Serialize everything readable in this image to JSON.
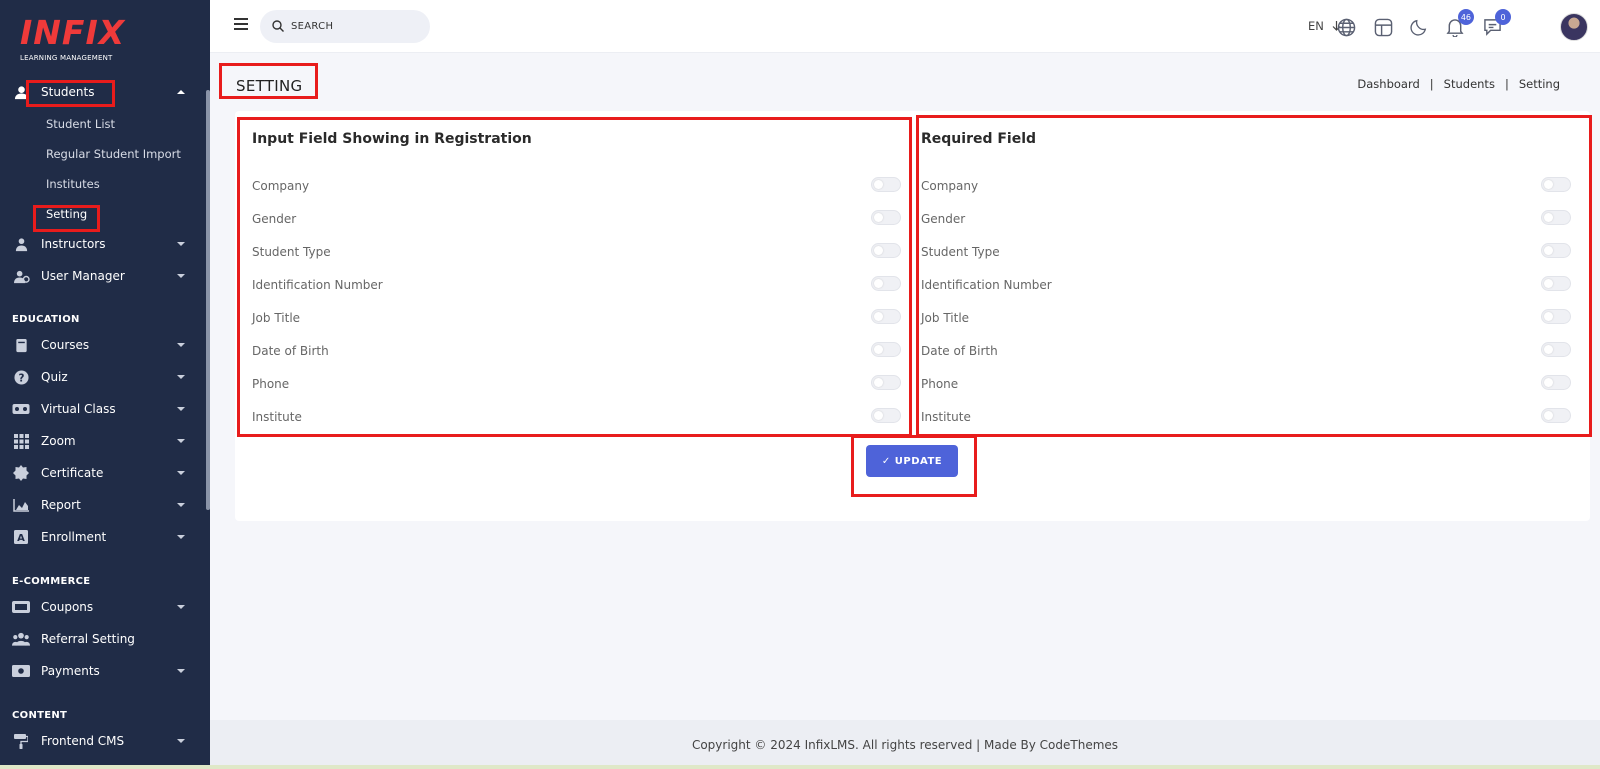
{
  "logo": {
    "main": "INFIX",
    "sub": "LEARNING MANAGEMENT"
  },
  "sidebar": {
    "students": {
      "label": "Students",
      "items": [
        "Student List",
        "Regular Student Import",
        "Institutes",
        "Setting"
      ]
    },
    "items_top": [
      {
        "label": "Instructors",
        "icon": "instructor-icon"
      },
      {
        "label": "User Manager",
        "icon": "user-manager-icon"
      }
    ],
    "sections": {
      "education": "EDUCATION",
      "ecommerce": "E-COMMERCE",
      "content": "CONTENT"
    },
    "education_items": [
      {
        "label": "Courses",
        "icon": "book-icon"
      },
      {
        "label": "Quiz",
        "icon": "question-icon"
      },
      {
        "label": "Virtual Class",
        "icon": "vr-icon"
      },
      {
        "label": "Zoom",
        "icon": "grid-icon"
      },
      {
        "label": "Certificate",
        "icon": "certificate-icon"
      },
      {
        "label": "Report",
        "icon": "chart-icon"
      },
      {
        "label": "Enrollment",
        "icon": "enrollment-icon"
      }
    ],
    "ecommerce_items": [
      {
        "label": "Coupons",
        "icon": "coupon-icon"
      },
      {
        "label": "Referral Setting",
        "icon": "users-icon"
      },
      {
        "label": "Payments",
        "icon": "money-icon"
      }
    ],
    "content_items": [
      {
        "label": "Frontend CMS",
        "icon": "paint-roller-icon"
      }
    ]
  },
  "topbar": {
    "search_placeholder": "SEARCH",
    "language": "EN",
    "notification_count": "46",
    "message_count": "0"
  },
  "page": {
    "title": "SETTING",
    "breadcrumb": [
      "Dashboard",
      "Students",
      "Setting"
    ]
  },
  "panels": {
    "left_title": "Input Field Showing in Registration",
    "right_title": "Required Field",
    "fields": [
      "Company",
      "Gender",
      "Student Type",
      "Identification Number",
      "Job Title",
      "Date of Birth",
      "Phone",
      "Institute"
    ]
  },
  "update_button": "UPDATE",
  "footer": "Copyright © 2024 InfixLMS. All rights reserved | Made By CodeThemes",
  "colors": {
    "sidebar": "#202c47",
    "accent": "#4e63d9",
    "highlight": "#e81c1c",
    "logo": "#ef3a3a"
  }
}
